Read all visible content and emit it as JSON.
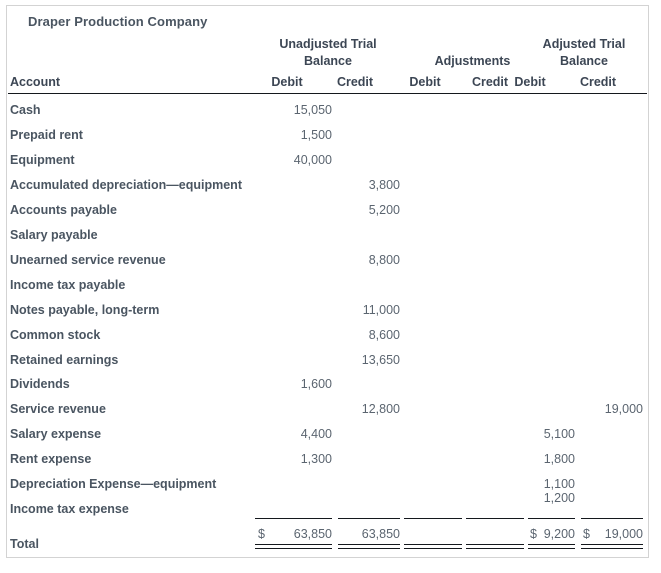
{
  "title": "Draper Production Company",
  "column_groups": {
    "unadjusted": "Unadjusted Trial\nBalance",
    "adjustments": "Adjustments",
    "adjusted": "Adjusted Trial\nBalance"
  },
  "column_headers": {
    "account": "Account",
    "unadjusted_debit": "Debit",
    "unadjusted_credit": "Credit",
    "adjustments_debit": "Debit",
    "adjustments_credit": "Credit",
    "adjusted_debit": "Debit",
    "adjusted_credit": "Credit"
  },
  "rows": [
    {
      "account": "Cash",
      "ud": "15,050",
      "uc": "",
      "ad": "",
      "ac": "",
      "td": "",
      "tc": ""
    },
    {
      "account": "Prepaid rent",
      "ud": "1,500",
      "uc": "",
      "ad": "",
      "ac": "",
      "td": "",
      "tc": ""
    },
    {
      "account": "Equipment",
      "ud": "40,000",
      "uc": "",
      "ad": "",
      "ac": "",
      "td": "",
      "tc": ""
    },
    {
      "account": "Accumulated depreciation—equipment",
      "ud": "",
      "uc": "3,800",
      "ad": "",
      "ac": "",
      "td": "",
      "tc": ""
    },
    {
      "account": "Accounts payable",
      "ud": "",
      "uc": "5,200",
      "ad": "",
      "ac": "",
      "td": "",
      "tc": ""
    },
    {
      "account": "Salary payable",
      "ud": "",
      "uc": "",
      "ad": "",
      "ac": "",
      "td": "",
      "tc": ""
    },
    {
      "account": "Unearned service revenue",
      "ud": "",
      "uc": "8,800",
      "ad": "",
      "ac": "",
      "td": "",
      "tc": ""
    },
    {
      "account": "Income tax payable",
      "ud": "",
      "uc": "",
      "ad": "",
      "ac": "",
      "td": "",
      "tc": ""
    },
    {
      "account": "Notes payable, long-term",
      "ud": "",
      "uc": "11,000",
      "ad": "",
      "ac": "",
      "td": "",
      "tc": ""
    },
    {
      "account": "Common stock",
      "ud": "",
      "uc": "8,600",
      "ad": "",
      "ac": "",
      "td": "",
      "tc": ""
    },
    {
      "account": "Retained earnings",
      "ud": "",
      "uc": "13,650",
      "ad": "",
      "ac": "",
      "td": "",
      "tc": ""
    },
    {
      "account": "Dividends",
      "ud": "1,600",
      "uc": "",
      "ad": "",
      "ac": "",
      "td": "",
      "tc": ""
    },
    {
      "account": "Service revenue",
      "ud": "",
      "uc": "12,800",
      "ad": "",
      "ac": "",
      "td": "",
      "tc": "19,000"
    },
    {
      "account": "Salary expense",
      "ud": "4,400",
      "uc": "",
      "ad": "",
      "ac": "",
      "td": "5,100",
      "tc": ""
    },
    {
      "account": "Rent expense",
      "ud": "1,300",
      "uc": "",
      "ad": "",
      "ac": "",
      "td": "1,800",
      "tc": ""
    },
    {
      "account": "Depreciation Expense—equipment",
      "ud": "",
      "uc": "",
      "ad": "",
      "ac": "",
      "td": "1,100",
      "tc": ""
    },
    {
      "account": "Income tax expense",
      "ud": "",
      "uc": "",
      "ad": "",
      "ac": "",
      "td": "1,200",
      "tc": ""
    }
  ],
  "total": {
    "label": "Total",
    "currency_symbol": "$",
    "unadjusted_debit": "63,850",
    "unadjusted_credit": "63,850",
    "adjustments_debit": "",
    "adjustments_credit": "",
    "adjusted_debit": "9,200",
    "adjusted_credit": "19,000"
  },
  "colors": {
    "text": "#4a5561",
    "number": "#5b6570",
    "rule": "#14181d",
    "border": "#d3d3d3"
  }
}
